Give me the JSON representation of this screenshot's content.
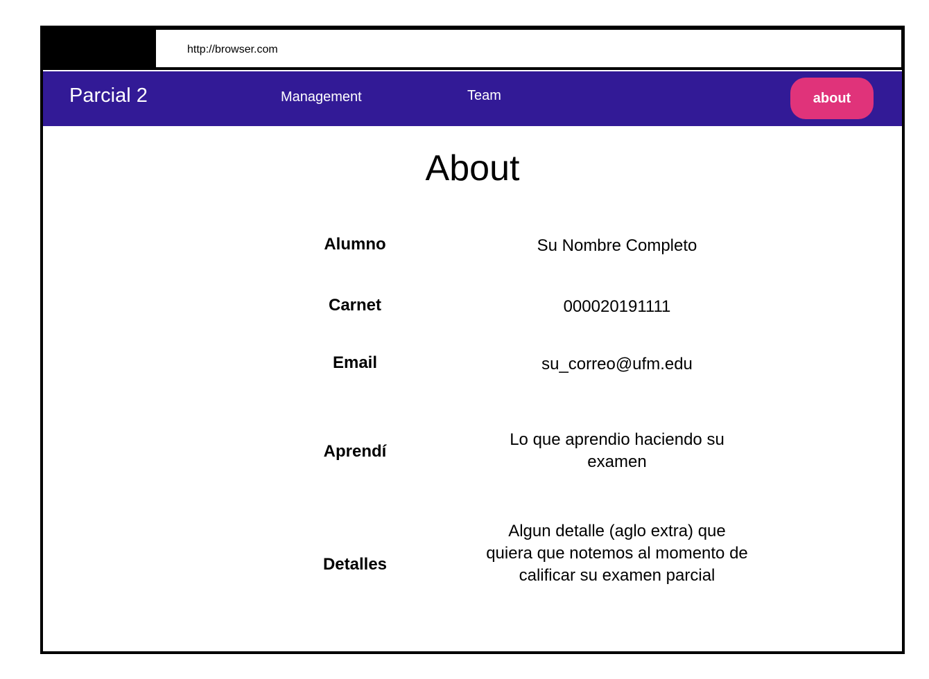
{
  "browser": {
    "url": "http://browser.com"
  },
  "navbar": {
    "brand": "Parcial 2",
    "links": [
      {
        "label": "Management"
      },
      {
        "label": "Team"
      }
    ],
    "active_button": "about",
    "active_color": "#e0337a",
    "background_color": "#321a96"
  },
  "main": {
    "title": "About",
    "rows": [
      {
        "label": "Alumno",
        "value": "Su Nombre Completo"
      },
      {
        "label": "Carnet",
        "value": "000020191111"
      },
      {
        "label": "Email",
        "value": "su_correo@ufm.edu"
      },
      {
        "label": "Aprendí",
        "value": "Lo que aprendio haciendo su examen"
      },
      {
        "label": "Detalles",
        "value": "Algun detalle (aglo extra) que quiera que notemos al momento de calificar su examen parcial"
      }
    ]
  }
}
